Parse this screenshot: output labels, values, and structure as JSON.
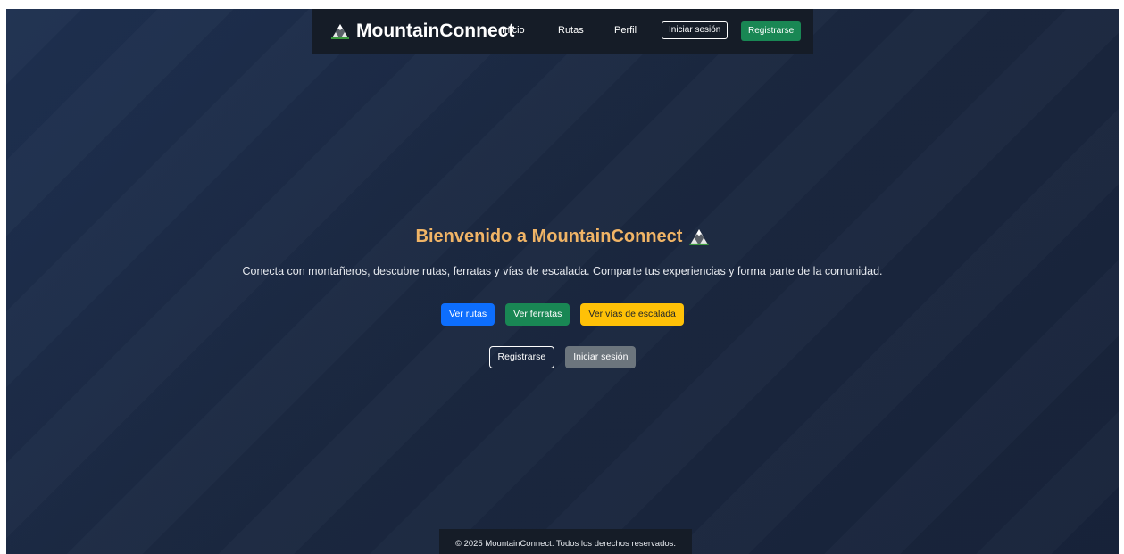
{
  "navbar": {
    "brand": "MountainConnect",
    "brand_icon": "mountain-icon",
    "links": [
      "Inicio",
      "Rutas",
      "Perfil"
    ],
    "login_label": "Iniciar sesión",
    "register_label": "Registrarse"
  },
  "hero": {
    "title": "Bienvenido a MountainConnect",
    "title_icon": "mountain-icon",
    "subtitle": "Conecta con montañeros, descubre rutas, ferratas y vías de escalada. Comparte tus experiencias y forma parte de la comunidad.",
    "primary_buttons": {
      "routes": "Ver rutas",
      "ferratas": "Ver ferratas",
      "climbing": "Ver vías de escalada"
    },
    "secondary_buttons": {
      "register": "Registrarse",
      "login": "Iniciar sesión"
    }
  },
  "footer": {
    "text": "© 2025 MountainConnect. Todos los derechos reservados."
  },
  "colors": {
    "background": "#1b2840",
    "navbar": "#151c27",
    "title": "#f0b466",
    "blue": "#0d6efd",
    "green": "#198754",
    "yellow": "#ffc107",
    "gray": "#6c757d"
  }
}
